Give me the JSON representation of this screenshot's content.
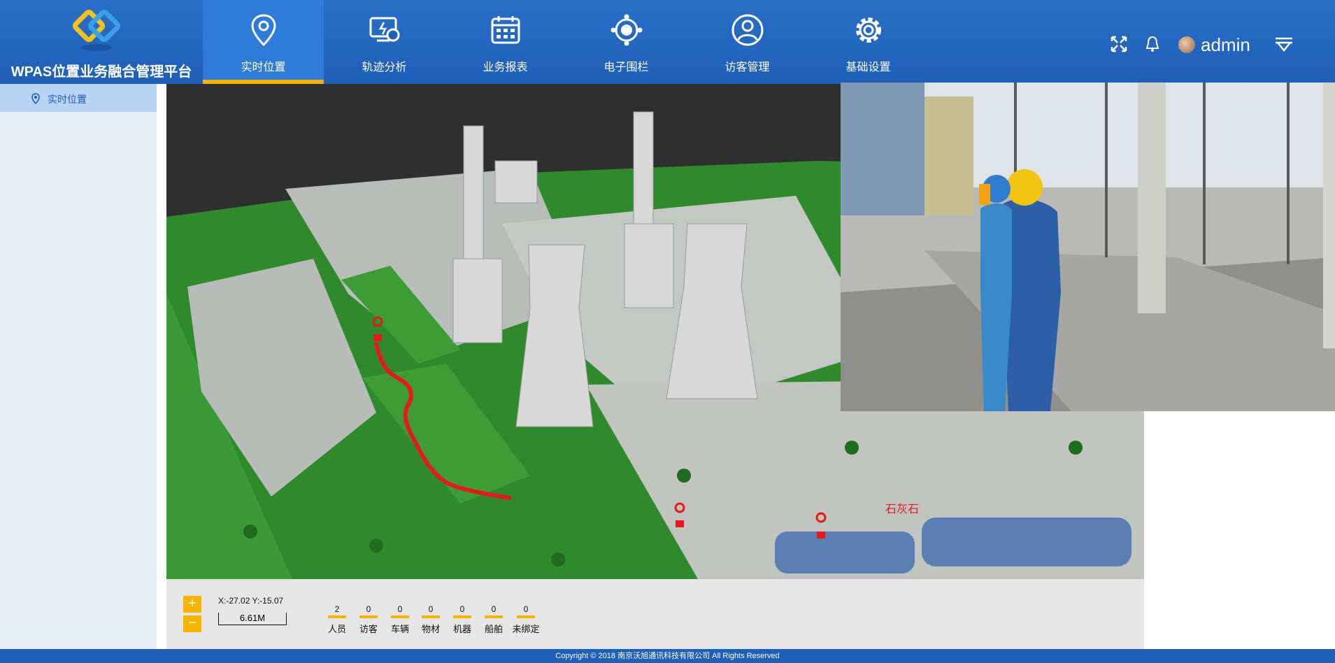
{
  "app": {
    "title": "WPAS位置业务融合管理平台"
  },
  "nav": {
    "items": [
      {
        "label": "实时位置",
        "icon": "location-pin-icon"
      },
      {
        "label": "轨迹分析",
        "icon": "track-analysis-icon"
      },
      {
        "label": "业务报表",
        "icon": "calendar-report-icon"
      },
      {
        "label": "电子围栏",
        "icon": "fence-icon"
      },
      {
        "label": "访客管理",
        "icon": "visitor-user-icon"
      },
      {
        "label": "基础设置",
        "icon": "gear-icon"
      }
    ],
    "active_index": 0
  },
  "header": {
    "username": "admin",
    "icons": [
      "fullscreen-icon",
      "bell-icon",
      "avatar",
      "menu-icon"
    ]
  },
  "sidebar": {
    "items": [
      {
        "label": "实时位置",
        "icon": "location-pin-icon"
      }
    ]
  },
  "map": {
    "place_label": "石灰石",
    "colors": {
      "path": "#e51b1b",
      "ground": "#2f8a2c"
    }
  },
  "controls": {
    "zoom_in": "+",
    "zoom_out": "−",
    "coords": "X:-27.02 Y:-15.07",
    "scale": "6.61M"
  },
  "stats": [
    {
      "label": "人员",
      "value": "2"
    },
    {
      "label": "访客",
      "value": "0"
    },
    {
      "label": "车辆",
      "value": "0"
    },
    {
      "label": "物材",
      "value": "0"
    },
    {
      "label": "机器",
      "value": "0"
    },
    {
      "label": "船舶",
      "value": "0"
    },
    {
      "label": "未绑定",
      "value": "0"
    }
  ],
  "footer": {
    "copyright": "Copyright © 2018   南京沃旭通讯科技有限公司 All Rights Reserved"
  },
  "colors": {
    "header": "#1e5fb8",
    "active_nav": "#2f7bd9",
    "accent": "#f4b400",
    "sidebar": "#e9eff9"
  }
}
